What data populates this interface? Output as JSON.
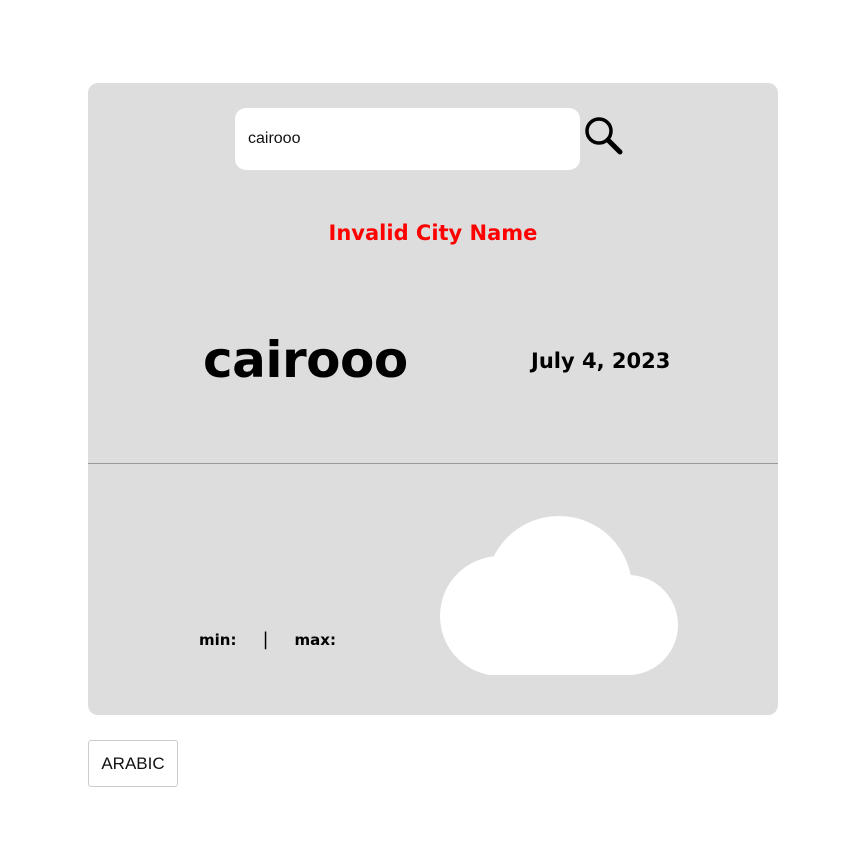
{
  "search": {
    "value": "cairooo",
    "placeholder": ""
  },
  "error_message": "Invalid City Name",
  "weather": {
    "city": "cairooo",
    "date": "July 4, 2023",
    "min_label": "min:",
    "separator": "|",
    "max_label": "max:",
    "condition_icon": "cloud-icon"
  },
  "language_button_label": "ARABIC",
  "colors": {
    "card_background": "#dddddd",
    "error_text": "#ff0000",
    "page_background": "#ffffff"
  }
}
